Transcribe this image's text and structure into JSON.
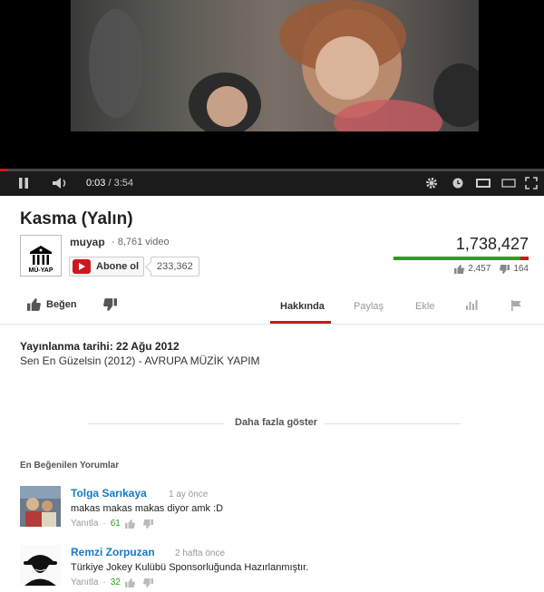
{
  "player": {
    "current_time": "0:03",
    "separator": " / ",
    "duration": "3:54",
    "progress": 0.013
  },
  "video": {
    "title": "Kasma (Yalın)",
    "channel": "muyap",
    "video_count": "· 8,761 video",
    "logo_text": "MÜ-YAP",
    "subscribe_label": "Abone ol",
    "subscriber_count": "233,362",
    "views": "1,738,427",
    "likes": "2,457",
    "dislikes": "164",
    "like_ratio": 0.937
  },
  "actions": {
    "like_label": "Beğen",
    "tabs": [
      "Hakkında",
      "Paylaş",
      "Ekle"
    ]
  },
  "description": {
    "published": "Yayınlanma tarihi: 22 Ağu 2012",
    "text": "Sen En Güzelsin (2012) - AVRUPA MÜZİK YAPIM",
    "show_more": "Daha fazla göster"
  },
  "comments": {
    "heading": "En Beğenilen Yorumlar",
    "items": [
      {
        "author": "Tolga Sarıkaya",
        "ago": "1 ay önce",
        "text": "makas makas makas diyor amk :D",
        "reply": "Yanıtla",
        "dot": "·",
        "score": "61"
      },
      {
        "author": "Remzi Zorpuzan",
        "ago": "2 hafta önce",
        "text": "Türkiye Jokey Kulübü Sponsorluğunda Hazırlanmıştır.",
        "reply": "Yanıtla",
        "dot": "·",
        "score": "32"
      }
    ]
  },
  "colors": {
    "accent_red": "#cc181e",
    "like_green": "#2b9f1f",
    "link_blue": "#167ac6"
  }
}
